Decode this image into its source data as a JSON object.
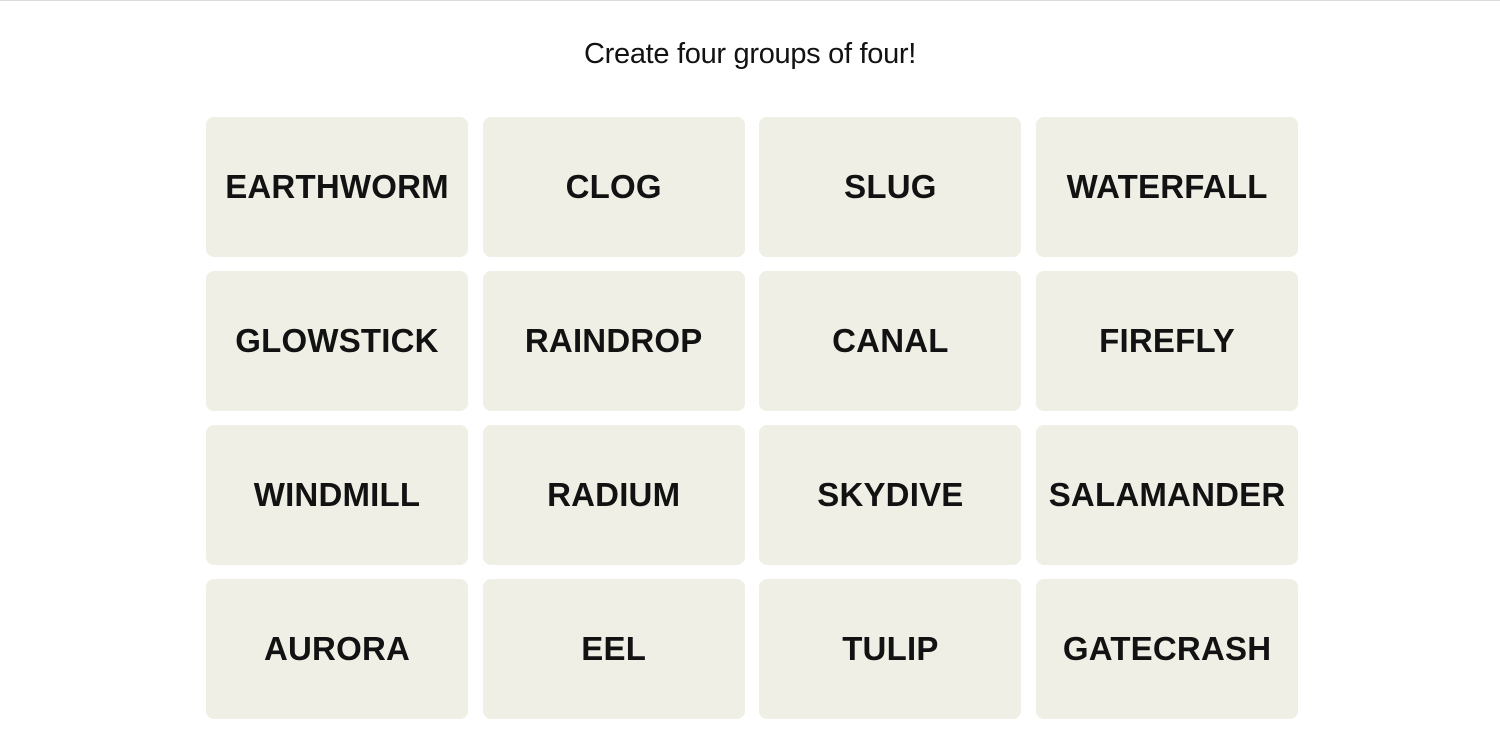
{
  "game": {
    "prompt": "Create four groups of four!",
    "tiles": [
      "EARTHWORM",
      "CLOG",
      "SLUG",
      "WATERFALL",
      "GLOWSTICK",
      "RAINDROP",
      "CANAL",
      "FIREFLY",
      "WINDMILL",
      "RADIUM",
      "SKYDIVE",
      "SALAMANDER",
      "AURORA",
      "EEL",
      "TULIP",
      "GATECRASH"
    ]
  }
}
